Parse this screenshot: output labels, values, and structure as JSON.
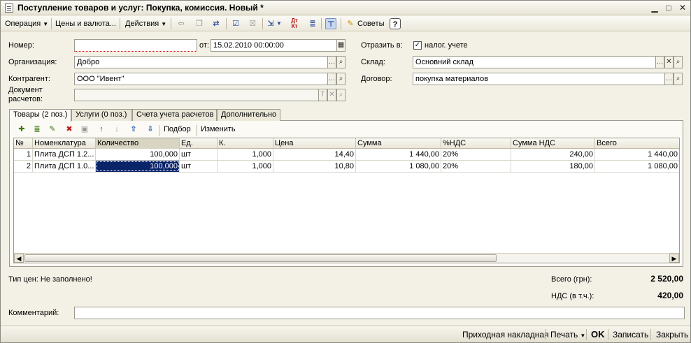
{
  "window": {
    "title": "Поступление товаров и услуг: Покупка, комиссия. Новый *"
  },
  "toolbar": {
    "operation_label": "Операция",
    "prices_label": "Цены и валюта...",
    "actions_label": "Действия",
    "tips_label": "Советы",
    "help_label": "?",
    "dtkt_label": "Дт Кт"
  },
  "form": {
    "number_label": "Номер:",
    "number_value": "",
    "date_label": "от:",
    "date_value": "15.02.2010 00:00:00",
    "org_label": "Организация:",
    "org_value": "Добро",
    "contractor_label": "Контрагент:",
    "contractor_value": "ООО \"Ивент\"",
    "doc_label_1": "Документ",
    "doc_label_2": "расчетов:",
    "doc_value": "",
    "reflect_label": "Отразить в:",
    "tax_label": "налог. учете",
    "tax_checked": "✓",
    "warehouse_label": "Склад:",
    "warehouse_value": "Основний склад",
    "contract_label": "Договор:",
    "contract_value": "покупка материалов"
  },
  "tabs": [
    {
      "label": "Товары (2 поз.)"
    },
    {
      "label": "Услуги (0 поз.)"
    },
    {
      "label": "Счета учета расчетов"
    },
    {
      "label": "Дополнительно"
    }
  ],
  "grid_toolbar": {
    "pick_label": "Подбор",
    "change_label": "Изменить"
  },
  "table": {
    "columns": [
      "№",
      "Номенклатура",
      "Количество",
      "Ед.",
      "К.",
      "Цена",
      "Сумма",
      "%НДС",
      "Сумма НДС",
      "Всего"
    ],
    "rows": [
      [
        "1",
        "Плита ДСП 1.2...",
        "100,000",
        "шт",
        "1,000",
        "14,40",
        "1 440,00",
        "20%",
        "240,00",
        "1 440,00"
      ],
      [
        "2",
        "Плита ДСП 1.0...",
        "100,000",
        "шт",
        "1,000",
        "10,80",
        "1 080,00",
        "20%",
        "180,00",
        "1 080,00"
      ]
    ]
  },
  "summary": {
    "price_type": "Тип цен: Не заполнено!",
    "total_label": "Всего (грн):",
    "total_value": "2 520,00",
    "vat_label": "НДС (в т.ч.):",
    "vat_value": "420,00",
    "comment_label": "Комментарий:",
    "comment_value": ""
  },
  "footer": {
    "invoice_label": "Приходная накладная",
    "print_label": "Печать",
    "ok_label": "OK",
    "save_label": "Записать",
    "close_label": "Закрыть"
  }
}
